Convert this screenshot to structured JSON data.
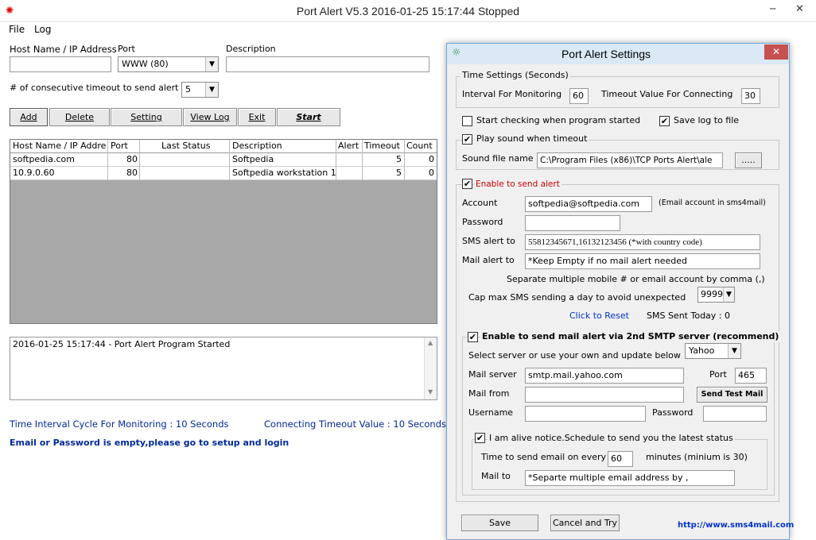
{
  "window": {
    "title": "Port Alert V5.3 2016-01-25 15:17:44 Stopped",
    "minimize": "─",
    "close": "✕"
  },
  "menu": [
    "File",
    "Log"
  ],
  "form": {
    "host_label": "Host Name / IP Address",
    "port_label": "Port",
    "port_value": "WWW   (80)",
    "desc_label": "Description",
    "timeout_label": "# of consecutive timeout to send alert",
    "timeout_value": "5"
  },
  "toolbar": {
    "add": "Add",
    "delete": "Delete",
    "setting": "Setting",
    "view_log": "View Log",
    "exit": "Exit",
    "start": "Start"
  },
  "table": {
    "headers": [
      "Host Name / IP Addre",
      "Port",
      "Last Status",
      "Description",
      "Alert",
      "Timeout",
      "Count"
    ],
    "rows": [
      [
        "softpedia.com",
        "80",
        "",
        "Softpedia",
        "",
        "5",
        "0"
      ],
      [
        "10.9.0.60",
        "80",
        "",
        "Softpedia workstation 1",
        "",
        "5",
        "0"
      ]
    ]
  },
  "log": {
    "line": "2016-01-25 15:17:44 - Port Alert Program Started"
  },
  "status": {
    "interval": "Time Interval Cycle For Monitoring : 10 Seconds",
    "connect": "Connecting Timeout Value : 10 Seconds",
    "warning": "Email or Password is empty,please go to setup and login"
  },
  "settings": {
    "title": "Port Alert  Settings",
    "time_group": "Time Settings (Seconds)",
    "interval_label": "Interval For Monitoring",
    "interval_value": "60",
    "timeout_label": "Timeout Value For Connecting",
    "timeout_value": "30",
    "start_check": "Start checking when program started",
    "save_log": "Save log to file",
    "play_sound": "Play sound when timeout",
    "sound_label": "Sound file name",
    "sound_value": "C:\\Program Files (x86)\\TCP Ports Alert\\ale",
    "browse": ".....",
    "enable_alert": "Enable to send alert",
    "account_label": "Account",
    "account_value": "softpedia@softpedia.com",
    "account_note": "(Email account in sms4mail)",
    "password_label": "Password",
    "sms_label": "SMS alert to",
    "sms_value": "55812345671,16132123456 (*with country code)",
    "mail_label": "Mail alert to",
    "mail_value": "*Keep Empty if no mail alert needed",
    "separate_note": "Separate multiple mobile # or email account by comma (,)",
    "cap_label": "Cap max SMS sending a day to avoid unexpected",
    "cap_value": "9999",
    "reset": "Click to Reset",
    "sms_sent": "SMS Sent Today : 0",
    "smtp_enable": "Enable to send mail alert via 2nd SMTP server (recommend)",
    "server_select_label": "Select server or use your own and update below",
    "server_select_value": "Yahoo",
    "mail_server_label": "Mail server",
    "mail_server_value": "smtp.mail.yahoo.com",
    "port_label": "Port",
    "port_value": "465",
    "mail_from_label": "Mail from",
    "send_test": "Send Test Mail",
    "username_label": "Username",
    "smtp_password_label": "Password",
    "alive_label": "I am alive notice.Schedule to send you the latest status",
    "time_every_label": "Time to send email on every",
    "time_every_value": "60",
    "minutes_note": "minutes (minium is 30)",
    "mail_to_label": "Mail to",
    "mail_to_value": "*Separte multiple email address by ,",
    "save": "Save",
    "cancel": "Cancel and Try",
    "link": "http://www.sms4mail.com"
  }
}
